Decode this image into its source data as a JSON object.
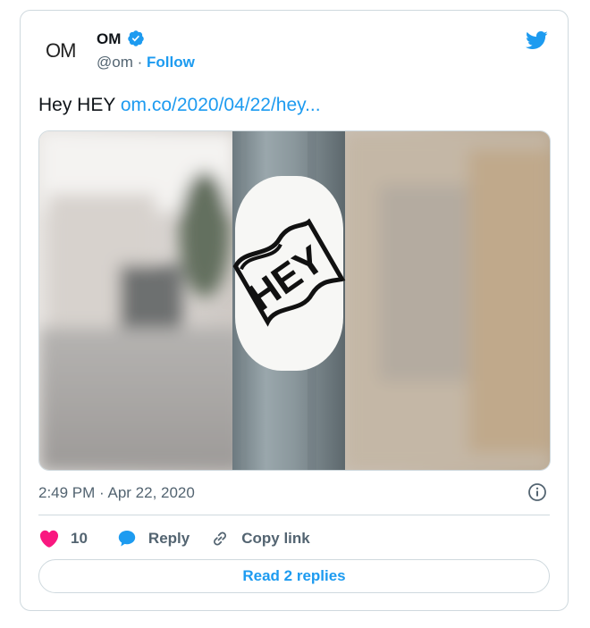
{
  "author": {
    "avatar_text": "OM",
    "name": "OM",
    "handle": "@om",
    "separator": " · ",
    "follow_label": "Follow"
  },
  "tweet": {
    "text": "Hey HEY ",
    "link_text": "om.co/2020/04/22/hey...",
    "image_sticker_text": "HEY",
    "timestamp": "2:49 PM · Apr 22, 2020"
  },
  "actions": {
    "like_count": "10",
    "reply_label": "Reply",
    "copy_label": "Copy link"
  },
  "footer": {
    "read_replies_label": "Read 2 replies"
  },
  "colors": {
    "accent": "#1d9bf0",
    "like": "#f91880",
    "muted": "#536471"
  }
}
